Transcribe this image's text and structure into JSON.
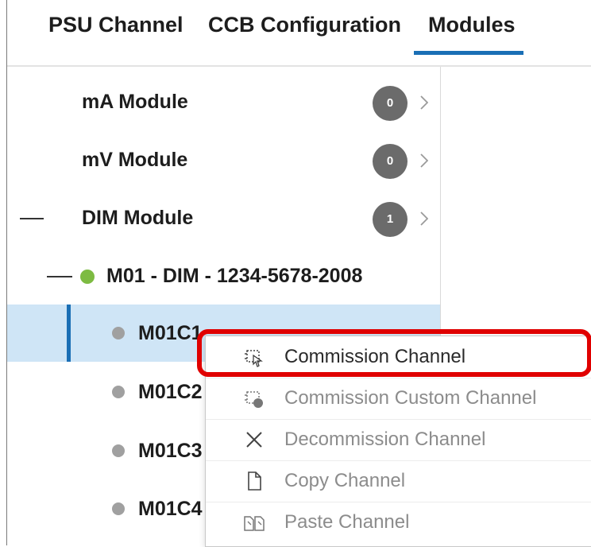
{
  "tabs": [
    {
      "label": "PSU Channel",
      "active": false
    },
    {
      "label": "CCB Configuration",
      "active": false
    },
    {
      "label": "Modules",
      "active": true
    }
  ],
  "tree": {
    "modules": [
      {
        "label": "mA Module",
        "count": "0",
        "icon": "chevron-right-icon"
      },
      {
        "label": "mV Module",
        "count": "0",
        "icon": "chevron-right-icon"
      },
      {
        "label": "DIM Module",
        "count": "1",
        "icon": "chevron-right-icon",
        "expanded": true
      }
    ],
    "device": {
      "label": "M01 - DIM - 1234-5678-2008",
      "status_color": "#7dbb42"
    },
    "channels": [
      {
        "label": "M01C1",
        "status_color": "#a0a0a0",
        "selected": true
      },
      {
        "label": "M01C2",
        "status_color": "#a0a0a0",
        "selected": false
      },
      {
        "label": "M01C3",
        "status_color": "#a0a0a0",
        "selected": false
      },
      {
        "label": "M01C4",
        "status_color": "#a0a0a0",
        "selected": false
      }
    ]
  },
  "context_menu": {
    "items": [
      {
        "label": "Commission Channel",
        "icon": "commission-icon",
        "enabled": true,
        "highlighted": true
      },
      {
        "label": "Commission Custom Channel",
        "icon": "commission-custom-icon",
        "enabled": false
      },
      {
        "label": "Decommission Channel",
        "icon": "close-icon",
        "enabled": false
      },
      {
        "label": "Copy Channel",
        "icon": "document-icon",
        "enabled": false
      },
      {
        "label": "Paste Channel",
        "icon": "paste-icon",
        "enabled": false
      }
    ]
  },
  "colors": {
    "accent": "#1a6fb5",
    "selection": "#cfe5f6",
    "highlight": "#e00000",
    "enabled_text": "#2a2a2a",
    "disabled_text": "#8c8c8c"
  }
}
